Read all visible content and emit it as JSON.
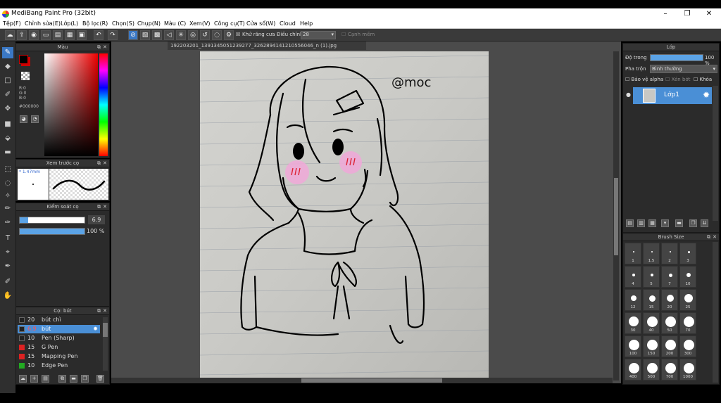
{
  "window": {
    "title": "MediBang Paint Pro (32bit)",
    "minimize": "–",
    "maximize": "❐",
    "close": "✕"
  },
  "menu": [
    "Tệp(F)",
    "Chỉnh sửa(E)",
    "Lớp(L)",
    "Bộ lọc(R)",
    "Chọn(S)",
    "Chụp(N)",
    "Màu (C)",
    "Xem(V)",
    "Công cụ(T)",
    "Cửa sổ(W)",
    "Cloud",
    "Help"
  ],
  "toolbar": {
    "antialias": "Khử răng cưa",
    "correction": "Điều chỉnh",
    "correction_value": "28",
    "smoothing": "Cạnh mềm"
  },
  "color_panel": {
    "title": "Màu",
    "r": "R:0",
    "g": "G:0",
    "b": "B:0",
    "hex": "#000000"
  },
  "preview_panel": {
    "title": "Xem trước cọ",
    "size": "* 1.47mm"
  },
  "brush_control": {
    "title": "Kiểm soát cọ",
    "size": "6.9",
    "opacity": "100 %",
    "opacity_value": 100
  },
  "brush_list": {
    "title": "Cọ: bút",
    "items": [
      {
        "size": "20",
        "name": "bút chì",
        "color": "#222222"
      },
      {
        "size": "6.9",
        "name": "bút",
        "color": "#222222"
      },
      {
        "size": "10",
        "name": "Pen (Sharp)",
        "color": "#222222"
      },
      {
        "size": "15",
        "name": "G Pen",
        "color": "#dd2222"
      },
      {
        "size": "15",
        "name": "Mapping Pen",
        "color": "#dd2222"
      },
      {
        "size": "10",
        "name": "Edge Pen",
        "color": "#22aa22"
      }
    ]
  },
  "document": {
    "tab": "192203201_1391345051239277_3262894141210556046_n (1).jpg",
    "signature": "@moc"
  },
  "layer_panel": {
    "title": "Lớp",
    "opacity_label": "Độ trong",
    "opacity": "100 %",
    "opacity_value": 100,
    "blend_label": "Pha trộn",
    "blend": "Bình thường",
    "protect_alpha": "Bảo vệ alpha",
    "clip": "Xén bớt",
    "lock": "Khóa",
    "layer_name": "Lớp1"
  },
  "brush_size_panel": {
    "title": "Brush Size",
    "sizes": [
      "1",
      "1.5",
      "2",
      "3",
      "4",
      "5",
      "7",
      "10",
      "12",
      "15",
      "20",
      "25",
      "30",
      "40",
      "50",
      "70",
      "100",
      "150",
      "200",
      "300",
      "400",
      "500",
      "700",
      "1000"
    ]
  }
}
